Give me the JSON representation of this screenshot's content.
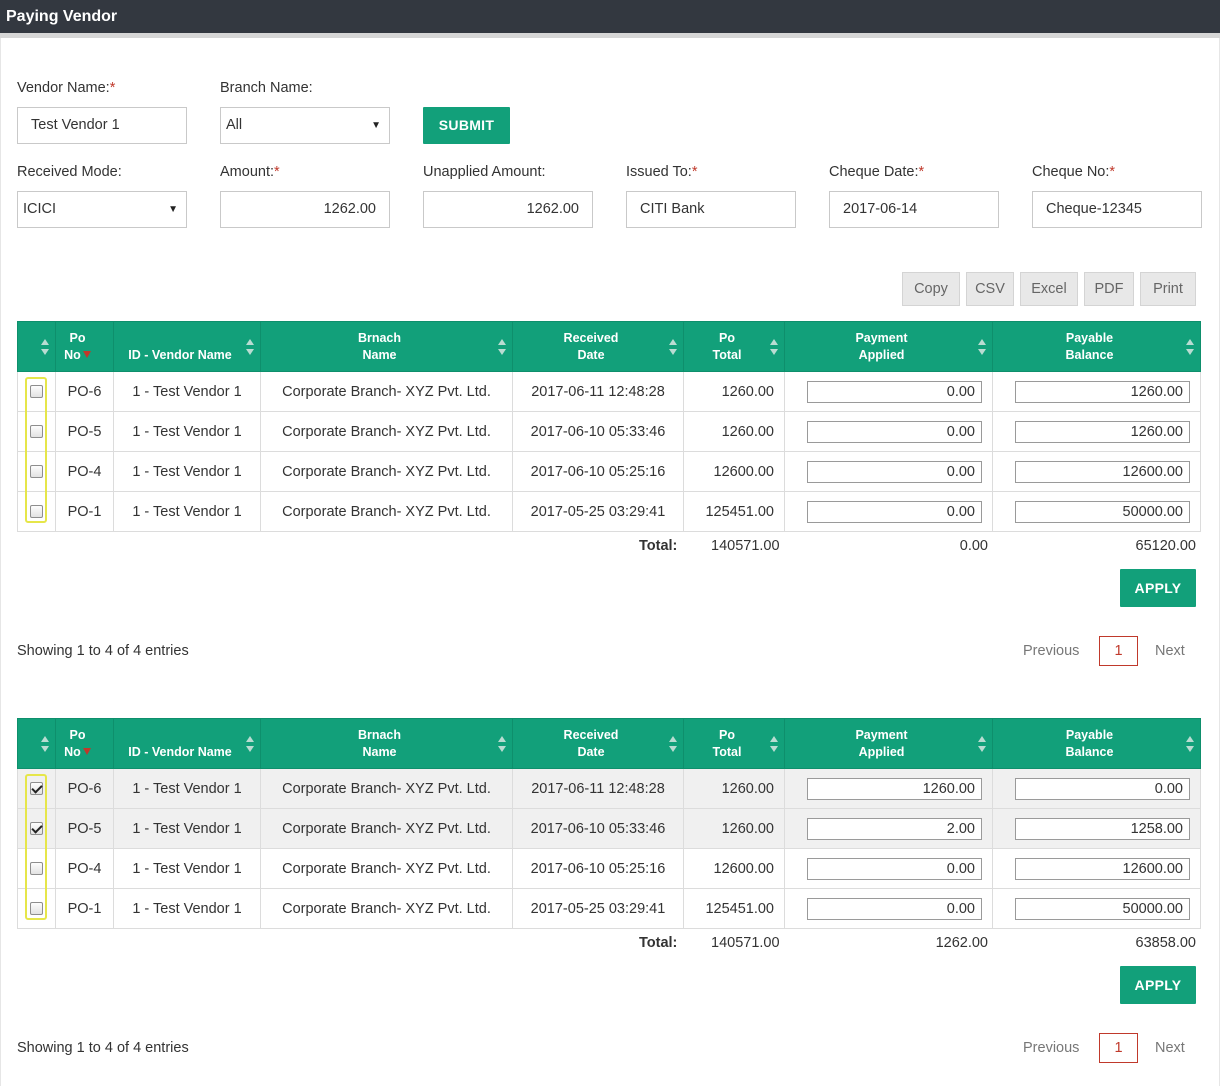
{
  "window": {
    "title": "Paying Vendor"
  },
  "form": {
    "vendor_name": {
      "label": "Vendor Name:",
      "required": "*",
      "value": "Test Vendor 1"
    },
    "branch_name": {
      "label": "Branch Name:",
      "value": "All"
    },
    "submit_label": "SUBMIT",
    "received_mode": {
      "label": "Received Mode:",
      "value": "ICICI"
    },
    "amount": {
      "label": "Amount:",
      "required": "*",
      "value": "1262.00"
    },
    "unapplied_amount": {
      "label": "Unapplied Amount:",
      "value": "1262.00"
    },
    "issued_to": {
      "label": "Issued To:",
      "required": "*",
      "value": "CITI Bank"
    },
    "cheque_date": {
      "label": "Cheque Date:",
      "required": "*",
      "value": "2017-06-14"
    },
    "cheque_no": {
      "label": "Cheque No:",
      "required": "*",
      "value": "Cheque-12345"
    }
  },
  "export_buttons": [
    "Copy",
    "CSV",
    "Excel",
    "PDF",
    "Print"
  ],
  "columns": [
    {
      "line1": "Po",
      "line2": "No"
    },
    {
      "line1": "",
      "line2": "ID - Vendor Name"
    },
    {
      "line1": "Brnach",
      "line2": "Name"
    },
    {
      "line1": "Received",
      "line2": "Date"
    },
    {
      "line1": "Po",
      "line2": "Total"
    },
    {
      "line1": "Payment",
      "line2": "Applied"
    },
    {
      "line1": "Payable",
      "line2": "Balance"
    }
  ],
  "tables": [
    {
      "rows": [
        {
          "checked": false,
          "po_no": "PO-6",
          "vendor": "1 - Test Vendor 1",
          "branch": "Corporate Branch- XYZ Pvt. Ltd.",
          "date": "2017-06-11 12:48:28",
          "po_total": "1260.00",
          "applied": "0.00",
          "balance": "1260.00"
        },
        {
          "checked": false,
          "po_no": "PO-5",
          "vendor": "1 - Test Vendor 1",
          "branch": "Corporate Branch- XYZ Pvt. Ltd.",
          "date": "2017-06-10 05:33:46",
          "po_total": "1260.00",
          "applied": "0.00",
          "balance": "1260.00"
        },
        {
          "checked": false,
          "po_no": "PO-4",
          "vendor": "1 - Test Vendor 1",
          "branch": "Corporate Branch- XYZ Pvt. Ltd.",
          "date": "2017-06-10 05:25:16",
          "po_total": "12600.00",
          "applied": "0.00",
          "balance": "12600.00"
        },
        {
          "checked": false,
          "po_no": "PO-1",
          "vendor": "1 - Test Vendor 1",
          "branch": "Corporate Branch- XYZ Pvt. Ltd.",
          "date": "2017-05-25 03:29:41",
          "po_total": "125451.00",
          "applied": "0.00",
          "balance": "50000.00"
        }
      ],
      "totals": {
        "label": "Total:",
        "po_total": "140571.00",
        "applied": "0.00",
        "balance": "65120.00"
      },
      "apply_label": "APPLY",
      "info": "Showing 1 to 4 of 4 entries",
      "pager": {
        "previous": "Previous",
        "page": "1",
        "next": "Next"
      }
    },
    {
      "rows": [
        {
          "checked": true,
          "po_no": "PO-6",
          "vendor": "1 - Test Vendor 1",
          "branch": "Corporate Branch- XYZ Pvt. Ltd.",
          "date": "2017-06-11 12:48:28",
          "po_total": "1260.00",
          "applied": "1260.00",
          "balance": "0.00"
        },
        {
          "checked": true,
          "po_no": "PO-5",
          "vendor": "1 - Test Vendor 1",
          "branch": "Corporate Branch- XYZ Pvt. Ltd.",
          "date": "2017-06-10 05:33:46",
          "po_total": "1260.00",
          "applied": "2.00",
          "balance": "1258.00"
        },
        {
          "checked": false,
          "po_no": "PO-4",
          "vendor": "1 - Test Vendor 1",
          "branch": "Corporate Branch- XYZ Pvt. Ltd.",
          "date": "2017-06-10 05:25:16",
          "po_total": "12600.00",
          "applied": "0.00",
          "balance": "12600.00"
        },
        {
          "checked": false,
          "po_no": "PO-1",
          "vendor": "1 - Test Vendor 1",
          "branch": "Corporate Branch- XYZ Pvt. Ltd.",
          "date": "2017-05-25 03:29:41",
          "po_total": "125451.00",
          "applied": "0.00",
          "balance": "50000.00"
        }
      ],
      "totals": {
        "label": "Total:",
        "po_total": "140571.00",
        "applied": "1262.00",
        "balance": "63858.00"
      },
      "apply_label": "APPLY",
      "info": "Showing 1 to 4 of 4 entries",
      "pager": {
        "previous": "Previous",
        "page": "1",
        "next": "Next"
      }
    }
  ],
  "colors": {
    "accent": "#12a07a",
    "title_bar": "#333840",
    "required": "#c0392b",
    "highlight": "#e6e64a"
  }
}
